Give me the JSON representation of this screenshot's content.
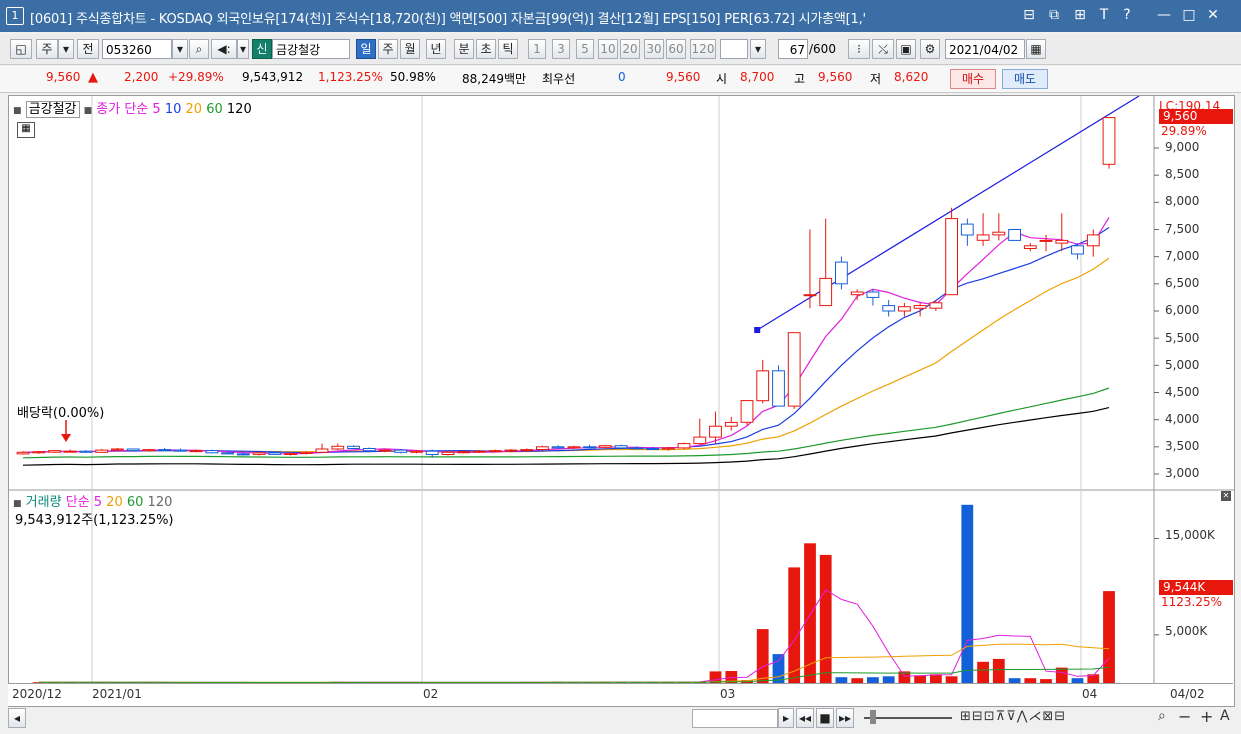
{
  "window": {
    "number": "1",
    "title": "[0601] 주식종합차트 - KOSDAQ 외국인보유[174(천)] 주식수[18,720(천)] 액면[500] 자본금[99(억)] 결산[12월] EPS[150] PER[63.72] 시가총액[1,'",
    "controls": [
      "⊟",
      "⧉",
      "⊞",
      "T",
      "?",
      "—",
      "□",
      "✕"
    ]
  },
  "toolbar": {
    "type_button": "주",
    "prev_button": "전",
    "code_value": "053260",
    "new_badge": "신",
    "stock_name": "금강철강",
    "periods": [
      "일",
      "주",
      "월",
      "년",
      "분",
      "초",
      "틱"
    ],
    "selected_period": "일",
    "intervals": [
      "1",
      "3",
      "5",
      "10",
      "20",
      "30",
      "60",
      "120"
    ],
    "count_value": "67",
    "count_max": "/600",
    "date_value": "2021/04/02"
  },
  "quote": {
    "price": "9,560",
    "change": "2,200",
    "change_pct": "+29.89%",
    "volume": "9,543,912",
    "volume_pct": "1,123.25%",
    "ratio": "50.98%",
    "amount": "88,249백만",
    "best_label": "최우선",
    "best_value": "0",
    "best_price": "9,560",
    "open_label": "시",
    "open": "8,700",
    "high_label": "고",
    "high": "9,560",
    "low_label": "저",
    "low": "8,620",
    "buy_button": "매수",
    "sell_button": "매도"
  },
  "price_panel": {
    "name": "금강철강",
    "ma_label": "종가 단순",
    "ma_periods": [
      "5",
      "10",
      "20",
      "60",
      "120"
    ],
    "ma_colors": [
      "#e020e0",
      "#1a3ee0",
      "#f0a000",
      "#1e9a2a",
      "#000000"
    ],
    "dividend_label": "배당락(0.00%)",
    "last_price_label": "9,560",
    "last_pct_label": "29.89%",
    "lc_label": "LC:190.14",
    "y_labels": [
      "9,000",
      "8,500",
      "8,000",
      "7,500",
      "7,000",
      "6,500",
      "6,000",
      "5,500",
      "5,000",
      "4,500",
      "4,000",
      "3,500",
      "3,000"
    ]
  },
  "volume_panel": {
    "name": "거래량",
    "ma_label": "단순",
    "ma_periods": [
      "5",
      "20",
      "60",
      "120"
    ],
    "current": "9,543,912주(1,123.25%)",
    "last_label": "9,544K",
    "last_pct": "1123.25%",
    "y_labels": [
      "15,000K",
      "5,000K"
    ]
  },
  "x_axis": {
    "labels": [
      "2020/12",
      "2021/01",
      "02",
      "03",
      "04"
    ],
    "right_label": "04/02"
  },
  "colors": {
    "up": "#e8170e",
    "down": "#1460d8",
    "trend": "#1a1ae0",
    "titlebar": "#3a6ea5"
  },
  "chart_data": {
    "type": "candlestick",
    "candles": [
      [
        3370,
        3420,
        3360,
        3400
      ],
      [
        3390,
        3420,
        3370,
        3410
      ],
      [
        3400,
        3440,
        3390,
        3430
      ],
      [
        3410,
        3450,
        3400,
        3420
      ],
      [
        3420,
        3440,
        3390,
        3400
      ],
      [
        3400,
        3460,
        3390,
        3440
      ],
      [
        3440,
        3480,
        3420,
        3460
      ],
      [
        3460,
        3470,
        3420,
        3430
      ],
      [
        3430,
        3460,
        3410,
        3450
      ],
      [
        3450,
        3480,
        3430,
        3440
      ],
      [
        3440,
        3470,
        3410,
        3420
      ],
      [
        3420,
        3450,
        3400,
        3430
      ],
      [
        3430,
        3450,
        3380,
        3390
      ],
      [
        3390,
        3420,
        3360,
        3370
      ],
      [
        3370,
        3400,
        3340,
        3360
      ],
      [
        3360,
        3400,
        3340,
        3390
      ],
      [
        3390,
        3410,
        3350,
        3360
      ],
      [
        3360,
        3390,
        3340,
        3380
      ],
      [
        3380,
        3420,
        3360,
        3400
      ],
      [
        3400,
        3560,
        3390,
        3460
      ],
      [
        3460,
        3560,
        3440,
        3510
      ],
      [
        3510,
        3530,
        3460,
        3470
      ],
      [
        3470,
        3490,
        3420,
        3430
      ],
      [
        3430,
        3460,
        3400,
        3440
      ],
      [
        3440,
        3460,
        3380,
        3400
      ],
      [
        3400,
        3440,
        3380,
        3420
      ],
      [
        3420,
        3450,
        3300,
        3360
      ],
      [
        3360,
        3420,
        3340,
        3400
      ],
      [
        3400,
        3430,
        3380,
        3410
      ],
      [
        3410,
        3440,
        3390,
        3420
      ],
      [
        3420,
        3450,
        3400,
        3430
      ],
      [
        3430,
        3460,
        3400,
        3440
      ],
      [
        3440,
        3470,
        3410,
        3450
      ],
      [
        3450,
        3520,
        3430,
        3500
      ],
      [
        3500,
        3530,
        3460,
        3480
      ],
      [
        3480,
        3520,
        3460,
        3500
      ],
      [
        3500,
        3540,
        3470,
        3490
      ],
      [
        3490,
        3530,
        3460,
        3520
      ],
      [
        3520,
        3540,
        3470,
        3480
      ],
      [
        3480,
        3510,
        3450,
        3470
      ],
      [
        3470,
        3500,
        3440,
        3460
      ],
      [
        3460,
        3500,
        3430,
        3480
      ],
      [
        3480,
        3580,
        3460,
        3560
      ],
      [
        3560,
        4020,
        3540,
        3680
      ],
      [
        3680,
        4150,
        3560,
        3880
      ],
      [
        3880,
        4050,
        3800,
        3950
      ],
      [
        3950,
        4350,
        3900,
        4350
      ],
      [
        4350,
        5100,
        4300,
        4900
      ],
      [
        4900,
        5000,
        4300,
        4250
      ],
      [
        4250,
        5600,
        4200,
        5600
      ],
      [
        6300,
        7500,
        6050,
        6300
      ],
      [
        6100,
        7700,
        6100,
        6600
      ],
      [
        6900,
        7000,
        6400,
        6500
      ],
      [
        6300,
        6400,
        6200,
        6350
      ],
      [
        6350,
        6400,
        6100,
        6250
      ],
      [
        6100,
        6200,
        5900,
        6000
      ],
      [
        6000,
        6150,
        5900,
        6080
      ],
      [
        6050,
        6150,
        5900,
        6100
      ],
      [
        6050,
        6200,
        6000,
        6150
      ],
      [
        6300,
        7900,
        6300,
        7700
      ],
      [
        7600,
        7700,
        7200,
        7400
      ],
      [
        7300,
        7800,
        7200,
        7400
      ],
      [
        7400,
        7800,
        7300,
        7450
      ],
      [
        7500,
        7500,
        7300,
        7300
      ],
      [
        7150,
        7250,
        7100,
        7200
      ],
      [
        7300,
        7400,
        7100,
        7300
      ],
      [
        7250,
        7800,
        7100,
        7300
      ],
      [
        7200,
        7250,
        6950,
        7050
      ],
      [
        7200,
        7500,
        7000,
        7400
      ],
      [
        8700,
        9560,
        8620,
        9560
      ]
    ],
    "volume_k": [
      80,
      60,
      70,
      90,
      60,
      50,
      70,
      80,
      60,
      50,
      70,
      60,
      50,
      60,
      40,
      50,
      60,
      50,
      60,
      120,
      100,
      80,
      60,
      50,
      60,
      70,
      50,
      60,
      80,
      70,
      60,
      70,
      80,
      120,
      90,
      80,
      100,
      110,
      90,
      100,
      80,
      120,
      160,
      1200,
      1250,
      300,
      5600,
      3000,
      12000,
      14500,
      13300,
      600,
      500,
      600,
      700,
      1200,
      800,
      900,
      700,
      18500,
      2200,
      2500,
      500,
      500,
      400,
      1600,
      500,
      900,
      9544
    ],
    "ma5": [
      3400,
      3410,
      3420,
      3440,
      3450,
      3460,
      3460,
      3440,
      3430,
      3420,
      3400,
      3390,
      3380,
      3390,
      3390,
      3400,
      3420,
      3430,
      3430,
      3440,
      3440,
      3430,
      3420,
      3420,
      3420,
      3430,
      3430,
      3440,
      3450,
      3460,
      3470,
      3480,
      3480,
      3480,
      3480,
      3480,
      3500,
      3560,
      3690,
      3810,
      3940,
      4180,
      4580,
      5040,
      5520,
      5980,
      6200,
      6350,
      6320,
      6250,
      6130,
      6080,
      6100,
      6240,
      6410,
      6610,
      6900,
      7100,
      7250,
      7380,
      7300,
      7200,
      7250,
      7300,
      7650
    ],
    "ylim": [
      2800,
      10000
    ]
  }
}
